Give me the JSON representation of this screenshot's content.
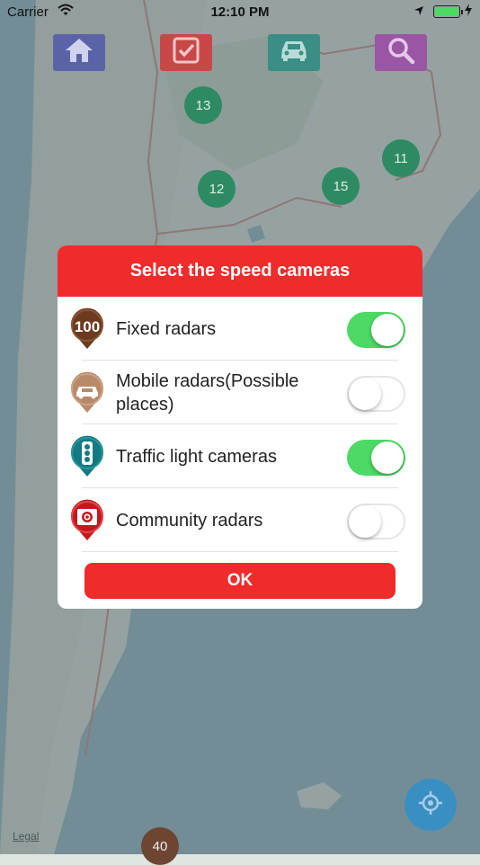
{
  "status_bar": {
    "carrier": "Carrier",
    "time": "12:10 PM",
    "battery_color": "#4cd964"
  },
  "toolbar": {
    "items": [
      {
        "icon": "home-icon",
        "color": "#5b63a8"
      },
      {
        "icon": "checklist-icon",
        "color": "#c84848"
      },
      {
        "icon": "car-icon",
        "color": "#3b8e86"
      },
      {
        "icon": "search-icon",
        "color": "#9a56a4"
      }
    ]
  },
  "map": {
    "clusters": [
      "13",
      "11",
      "12",
      "15",
      "40"
    ],
    "legal_label": "Legal"
  },
  "dialog": {
    "title": "Select the speed cameras",
    "items": [
      {
        "label": "Fixed radars",
        "enabled": true,
        "icon": "speed-limit-100-icon",
        "pin_color": "#6b3a1f"
      },
      {
        "label": "Mobile radars(Possible places)",
        "enabled": false,
        "icon": "mobile-car-icon",
        "pin_color": "#b88a6a"
      },
      {
        "label": "Traffic light cameras",
        "enabled": true,
        "icon": "traffic-light-icon",
        "pin_color": "#147a82"
      },
      {
        "label": "Community radars",
        "enabled": false,
        "icon": "community-camera-icon",
        "pin_color": "#c8161d"
      }
    ],
    "ok_label": "OK",
    "accent_color": "#ef2b2b",
    "switch_on_color": "#4cd964"
  }
}
